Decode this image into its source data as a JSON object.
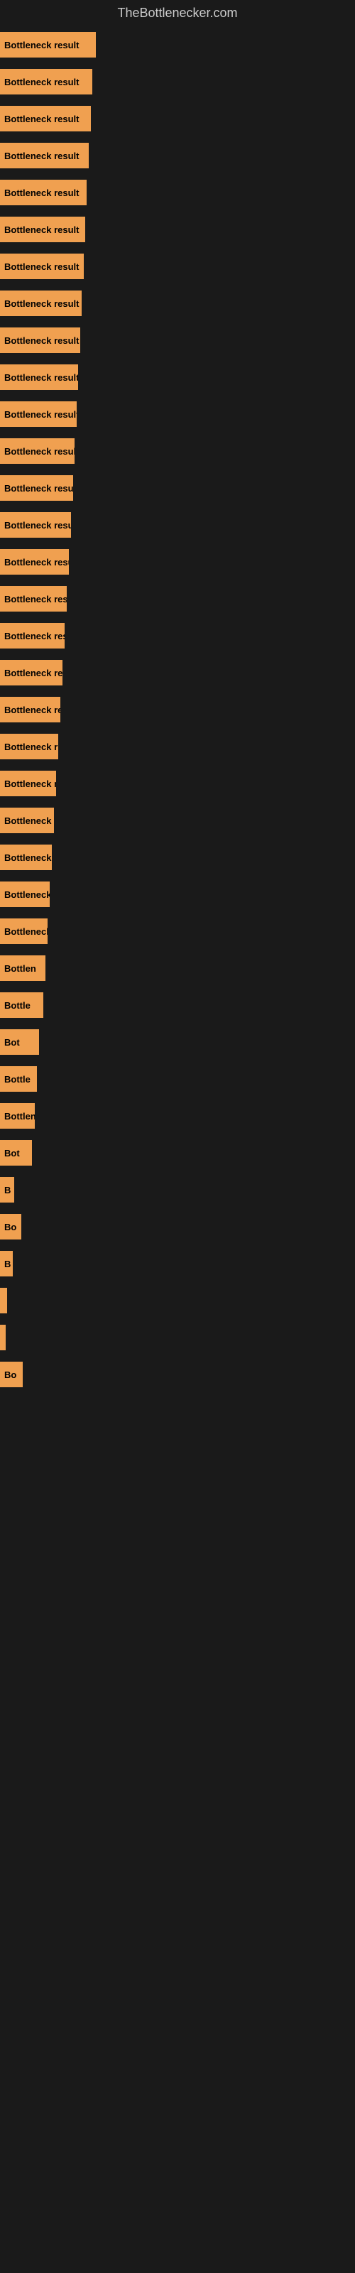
{
  "header": {
    "title": "TheBottlenecker.com"
  },
  "bars": [
    {
      "label": "Bottleneck result",
      "width": 135
    },
    {
      "label": "Bottleneck result",
      "width": 130
    },
    {
      "label": "Bottleneck result",
      "width": 128
    },
    {
      "label": "Bottleneck result",
      "width": 125
    },
    {
      "label": "Bottleneck result",
      "width": 122
    },
    {
      "label": "Bottleneck result",
      "width": 120
    },
    {
      "label": "Bottleneck result",
      "width": 118
    },
    {
      "label": "Bottleneck result",
      "width": 115
    },
    {
      "label": "Bottleneck result",
      "width": 113
    },
    {
      "label": "Bottleneck result",
      "width": 110
    },
    {
      "label": "Bottleneck result",
      "width": 108
    },
    {
      "label": "Bottleneck result",
      "width": 105
    },
    {
      "label": "Bottleneck result",
      "width": 103
    },
    {
      "label": "Bottleneck result",
      "width": 100
    },
    {
      "label": "Bottleneck result",
      "width": 97
    },
    {
      "label": "Bottleneck result",
      "width": 94
    },
    {
      "label": "Bottleneck result",
      "width": 91
    },
    {
      "label": "Bottleneck result",
      "width": 88
    },
    {
      "label": "Bottleneck resu",
      "width": 85
    },
    {
      "label": "Bottleneck r",
      "width": 82
    },
    {
      "label": "Bottleneck resu",
      "width": 79
    },
    {
      "label": "Bottleneck res",
      "width": 76
    },
    {
      "label": "Bottleneck result",
      "width": 73
    },
    {
      "label": "Bottleneck",
      "width": 70
    },
    {
      "label": "Bottleneck res",
      "width": 67
    },
    {
      "label": "Bottlen",
      "width": 64
    },
    {
      "label": "Bottle",
      "width": 61
    },
    {
      "label": "Bot",
      "width": 55
    },
    {
      "label": "Bottle",
      "width": 52
    },
    {
      "label": "Bottlene",
      "width": 49
    },
    {
      "label": "Bot",
      "width": 45
    },
    {
      "label": "B",
      "width": 20
    },
    {
      "label": "Bo",
      "width": 30
    },
    {
      "label": "B",
      "width": 18
    },
    {
      "label": "",
      "width": 10
    },
    {
      "label": "",
      "width": 8
    },
    {
      "label": "Bo",
      "width": 32
    }
  ]
}
